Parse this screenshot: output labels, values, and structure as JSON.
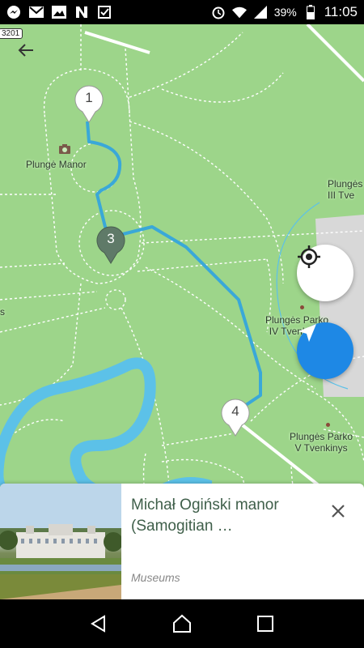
{
  "status_bar": {
    "left_icons": [
      "messenger-icon",
      "gmail-icon",
      "photos-icon",
      "n-app-icon",
      "checkmark-app-icon"
    ],
    "battery_percent": "39%",
    "time": "11:05"
  },
  "map": {
    "road_badge": "3201",
    "labels": {
      "manor": "Plungė Manor",
      "tvenkinys_3_line1": "Plungės",
      "tvenkinys_3_line2": "III Tve",
      "tvenkinys_4_line1": "Plungės Parko",
      "tvenkinys_4_line2": "IV Tvenkinys",
      "tvenkinys_5_line1": "Plungės Parko",
      "tvenkinys_5_line2": "V Tvenkinys",
      "left_edge": "s"
    },
    "pins": [
      {
        "number": "1"
      },
      {
        "number": "3"
      },
      {
        "number": "4"
      }
    ]
  },
  "card": {
    "title": "Michał Ogiński manor (Samogitian …",
    "category": "Museums"
  },
  "colors": {
    "map_green": "#9dd58a",
    "route_blue": "#3aa8d8",
    "river_blue": "#5cc1e8",
    "fab_blue": "#1e88e5",
    "card_title": "#3f5f4a"
  }
}
